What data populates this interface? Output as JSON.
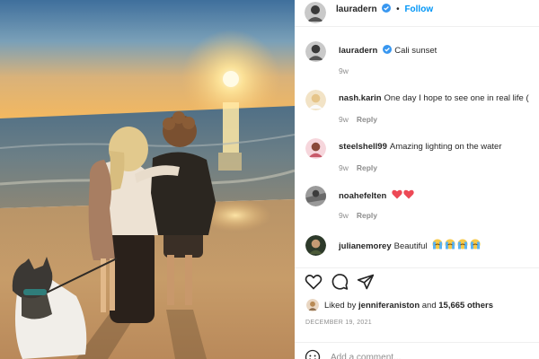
{
  "post": {
    "author": "lauradern",
    "follow_label": "Follow",
    "dot": "•",
    "caption": "Cali sunset",
    "caption_age": "9w",
    "photo_icon": "sunset-beach-photo"
  },
  "comments": [
    {
      "user": "nash.karin",
      "text": "One day I hope to see one in real life (",
      "age": "9w",
      "reply_label": "Reply"
    },
    {
      "user": "steelshell99",
      "text": "Amazing lighting on the water",
      "age": "9w",
      "reply_label": "Reply"
    },
    {
      "user": "noahefelten",
      "text": "",
      "age": "9w",
      "reply_label": "Reply",
      "emoji": "two-red-hearts"
    },
    {
      "user": "julianemorey",
      "text": "Beautiful",
      "emoji": "four-crying-face-emoji"
    }
  ],
  "likes": {
    "prefix": "Liked by",
    "first_liker": "jenniferaniston",
    "conjunction": "and",
    "others": "15,665 others"
  },
  "date": "DECEMBER 19, 2021",
  "add_comment": {
    "placeholder": "Add a comment..."
  },
  "icons": {
    "like": "heart-icon",
    "comment": "comment-icon",
    "share": "paper-plane-icon",
    "emoji": "smiley-icon",
    "verified": "verified-badge-icon"
  },
  "colors": {
    "follow": "#0095f6",
    "verified": "#3897f0",
    "muted": "#8e8e8e",
    "text": "#262626",
    "heart": "#ed4956"
  }
}
